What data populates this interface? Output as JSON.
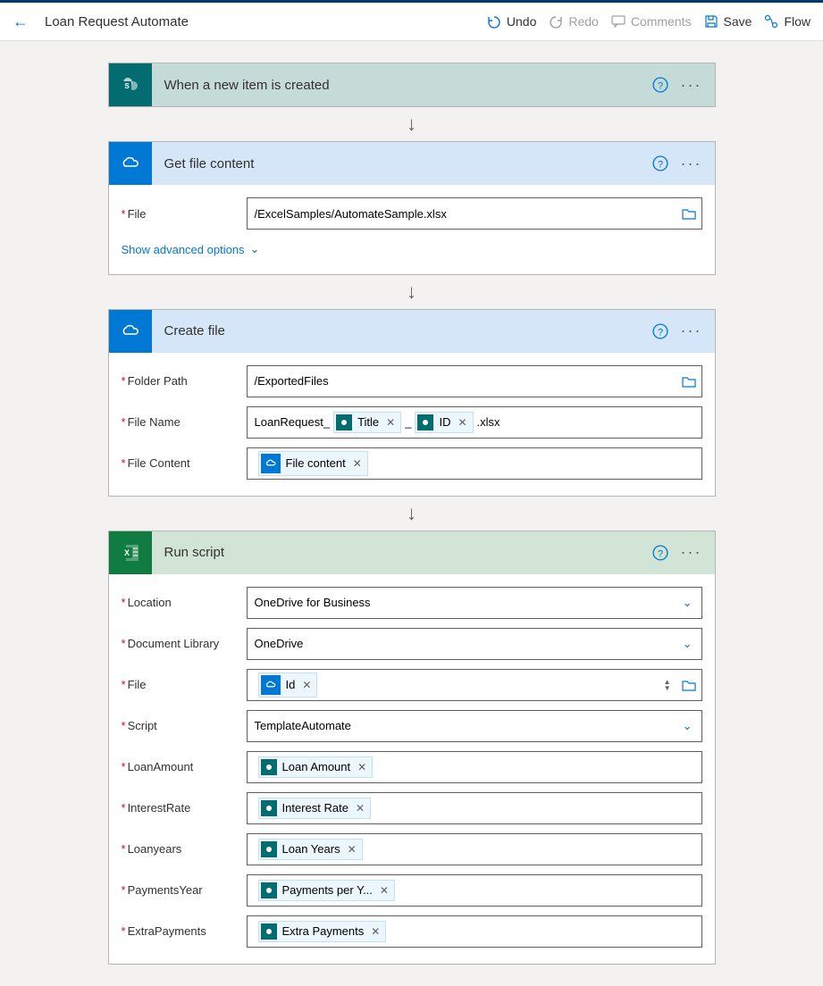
{
  "topbar": {
    "title": "Loan Request Automate",
    "undo": "Undo",
    "redo": "Redo",
    "comments": "Comments",
    "save": "Save",
    "flow": "Flow"
  },
  "card1": {
    "title": "When a new item is created"
  },
  "card2": {
    "title": "Get file content",
    "fileLabel": "File",
    "fileValue": "/ExcelSamples/AutomateSample.xlsx",
    "advanced": "Show advanced options"
  },
  "card3": {
    "title": "Create file",
    "folderLabel": "Folder Path",
    "folderValue": "/ExportedFiles",
    "filenameLabel": "File Name",
    "filenamePrefix": "LoanRequest_",
    "filenameMid": "_",
    "filenameSuffix": ".xlsx",
    "tokenTitle": "Title",
    "tokenId": "ID",
    "contentLabel": "File Content",
    "tokenFileContent": "File content"
  },
  "card4": {
    "title": "Run script",
    "locationLabel": "Location",
    "locationValue": "OneDrive for Business",
    "libraryLabel": "Document Library",
    "libraryValue": "OneDrive",
    "fileLabel": "File",
    "tokenIdLower": "Id",
    "scriptLabel": "Script",
    "scriptValue": "TemplateAutomate",
    "loanAmountLabel": "LoanAmount",
    "tokenLoanAmount": "Loan Amount",
    "interestLabel": "InterestRate",
    "tokenInterest": "Interest Rate",
    "yearsLabel": "Loanyears",
    "tokenYears": "Loan Years",
    "paymentsLabel": "PaymentsYear",
    "tokenPayments": "Payments per Y...",
    "extraLabel": "ExtraPayments",
    "tokenExtra": "Extra Payments"
  }
}
